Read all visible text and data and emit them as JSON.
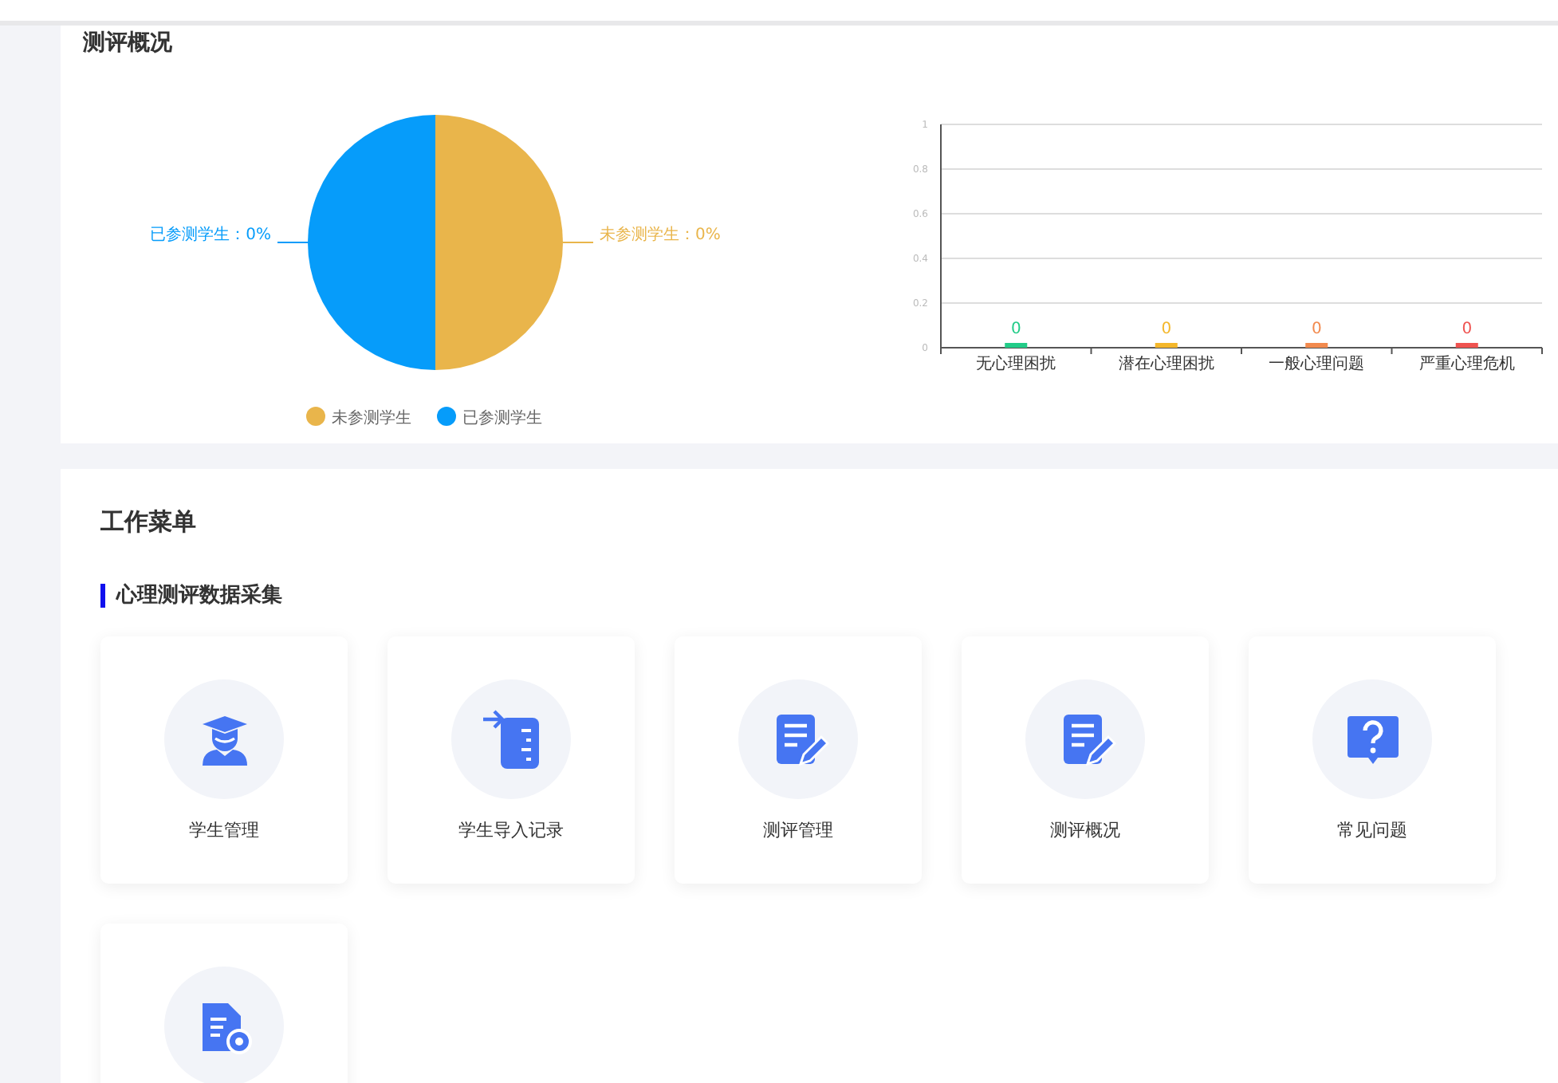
{
  "overview": {
    "title": "测评概况",
    "pie": {
      "labels": [
        "已参测学生：0%",
        "未参测学生：0%"
      ],
      "legend": [
        {
          "label": "未参测学生",
          "color": "#e9b54b"
        },
        {
          "label": "已参测学生",
          "color": "#069cfa"
        }
      ]
    },
    "bar": {
      "chart_data": {
        "type": "bar",
        "categories": [
          "无心理困扰",
          "潜在心理困扰",
          "一般心理问题",
          "严重心理危机"
        ],
        "stacked": true,
        "data_labels": true,
        "grid": true,
        "ylim": [
          0,
          1
        ],
        "yticks": [
          0,
          0.2,
          0.4,
          0.6,
          0.8,
          1
        ],
        "series": [
          {
            "color": "#22cc88",
            "values": [
              0,
              null,
              null,
              null
            ]
          },
          {
            "color": "#f4b72b",
            "values": [
              null,
              0,
              null,
              null
            ]
          },
          {
            "color": "#f28a4e",
            "values": [
              null,
              null,
              0,
              null
            ]
          },
          {
            "color": "#ef5350",
            "values": [
              null,
              null,
              null,
              0
            ]
          }
        ]
      }
    }
  },
  "work_menu": {
    "title": "工作菜单",
    "section": "心理测评数据采集",
    "items": [
      {
        "kind": "student",
        "label": "学生管理"
      },
      {
        "kind": "import",
        "label": "学生导入记录"
      },
      {
        "kind": "document",
        "label": "测评管理"
      },
      {
        "kind": "document",
        "label": "测评概况"
      },
      {
        "kind": "question",
        "label": "常见问题"
      },
      {
        "kind": "file-settings"
      }
    ]
  }
}
